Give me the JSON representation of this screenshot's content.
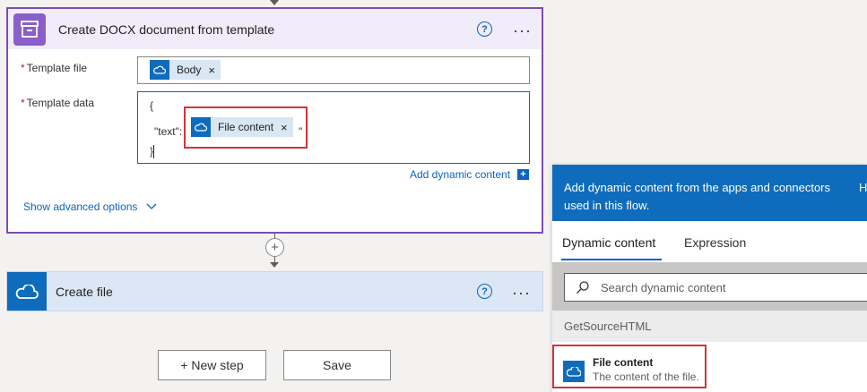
{
  "docx_action": {
    "title": "Create DOCX document from template",
    "template_file_label": "Template file",
    "template_file_token": "Body",
    "template_data_label": "Template data",
    "code_open": "{",
    "code_key": "\"text\":",
    "code_quote": "\"",
    "code_close": "}",
    "template_data_token": "File content",
    "add_dynamic_content": "Add dynamic content",
    "show_advanced": "Show advanced options"
  },
  "create_file_action": {
    "title": "Create file"
  },
  "buttons": {
    "new_step": "+ New step",
    "save": "Save"
  },
  "dynamic_panel": {
    "header_text": "Add dynamic content from the apps and connectors used in this flow.",
    "header_cutoff": "H",
    "tabs": [
      "Dynamic content",
      "Expression"
    ],
    "search_placeholder": "Search dynamic content",
    "group": "GetSourceHTML",
    "item_title": "File content",
    "item_description": "The content of the file."
  },
  "colors": {
    "docx_accent": "#7a4db8",
    "onedrive_blue": "#0f6cbd",
    "link_blue": "#0b63c4",
    "highlight_red": "#d13438"
  }
}
